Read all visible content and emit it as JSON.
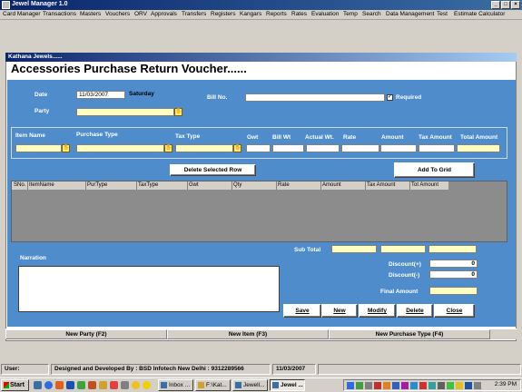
{
  "window": {
    "title": "Jewel Manager 1.0",
    "controls": [
      "_",
      "□",
      "×"
    ]
  },
  "menu": [
    "Card Manager",
    "Transactions",
    "Masters",
    "Vouchers",
    "ORV",
    "Approvals",
    "Transfers",
    "Registers",
    "Kangars",
    "Reports",
    "Rates",
    "Evaluation",
    "Temp",
    "Search",
    "Data Management",
    "Test",
    "Estimate Calculator"
  ],
  "form": {
    "window_title": "Kathana Jewels......",
    "heading": "Accessories Purchase Return Voucher......",
    "date_label": "Date",
    "date_value": "11/03/2007",
    "day_value": "Saturday",
    "bill_label": "Bill No.",
    "bill_value": "",
    "required_label": "Required",
    "required_checked": true,
    "party_label": "Party",
    "party_value": ""
  },
  "item_entry": {
    "item_name": "Item Name",
    "purchase_type": "Purchase Type",
    "tax_type": "Tax Type",
    "gwt": "Gwt",
    "bill_wt": "Bill Wt",
    "actual_wt": "Actual Wt.",
    "rate": "Rate",
    "amount": "Amount",
    "tax_amount": "Tax Amount",
    "total_amount": "Total Amount"
  },
  "buttons": {
    "delete_row": "Delete Selected Row",
    "add_to_grid": "Add To Grid",
    "save": "Save",
    "new": "New",
    "modify": "Modify",
    "delete": "Delete",
    "close": "Close"
  },
  "grid": {
    "columns": [
      "SNo.",
      "ItemName",
      "PurType",
      "TaxType",
      "Gwt",
      "Qty",
      "Rate",
      "Amount",
      "Tax Amount",
      "Tot Amount"
    ],
    "rows": []
  },
  "totals": {
    "sub_total_label": "Sub Total",
    "discount_plus_label": "Discount(+)",
    "discount_plus_value": "0",
    "discount_minus_label": "Discount(-)",
    "discount_minus_value": "0",
    "final_amount_label": "Final Amount"
  },
  "narration_label": "Narration",
  "shortcuts": [
    "New Party (F2)",
    "New Item (F3)",
    "New Purchase Type (F4)"
  ],
  "status": {
    "user_label": "User:",
    "developer": "Designed and Developed By : BSD Infotech New Delhi : 9312289566",
    "date": "11/03/2007"
  },
  "taskbar": {
    "start": "Start",
    "tasks": [
      "Inbox ...",
      "F:\\Kat...",
      "Jewell...",
      "Jewel ..."
    ],
    "clock": "2:39 PM"
  },
  "colors": {
    "form_blue": "#4f8ccc",
    "title_navy": "#0a246a",
    "field_yellow": "#ffffc0"
  }
}
